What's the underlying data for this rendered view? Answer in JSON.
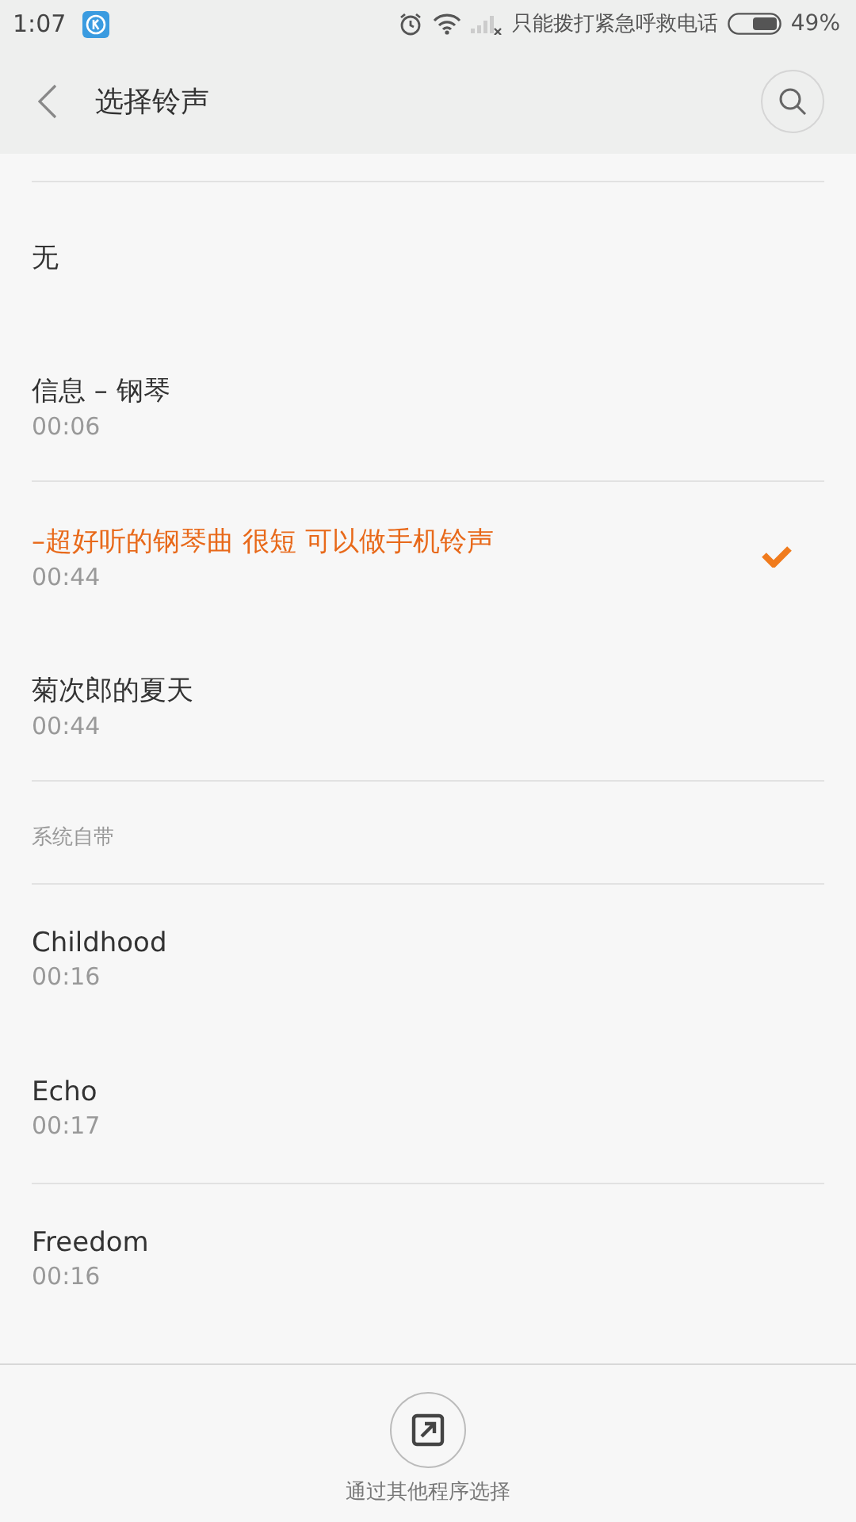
{
  "status_bar": {
    "time": "1:07",
    "carrier_text": "只能拨打紧急呼救电话",
    "battery": "49%"
  },
  "header": {
    "title": "选择铃声"
  },
  "groups": [
    {
      "items": [
        {
          "title": "无",
          "selected": false
        },
        {
          "title": "信息 – 钢琴",
          "duration": "00:06",
          "selected": false
        },
        {
          "title": "–超好听的钢琴曲 很短 可以做手机铃声",
          "duration": "00:44",
          "selected": true
        },
        {
          "title": "菊次郎的夏天",
          "duration": "00:44",
          "selected": false
        }
      ]
    },
    {
      "heading": "系统自带",
      "items": [
        {
          "title": "Childhood",
          "duration": "00:16",
          "selected": false
        },
        {
          "title": "Echo",
          "duration": "00:17",
          "selected": false
        },
        {
          "title": "Freedom",
          "duration": "00:16",
          "selected": false
        }
      ]
    }
  ],
  "footer": {
    "label": "通过其他程序选择"
  }
}
